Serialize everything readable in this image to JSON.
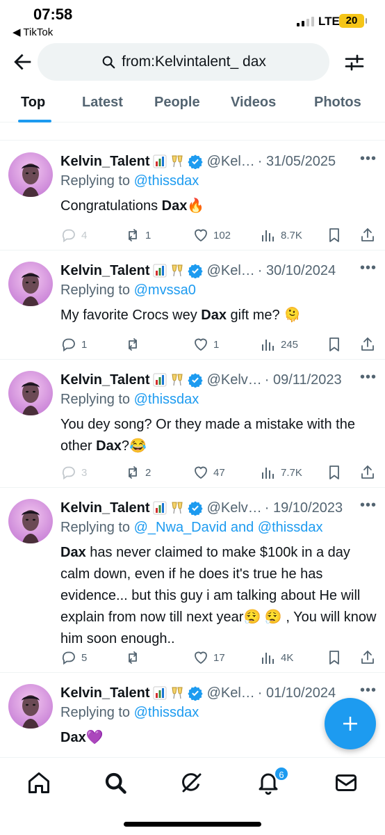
{
  "status_bar": {
    "time": "07:58",
    "back_app": "◀ TikTok",
    "network": "LTE",
    "battery": "20"
  },
  "search": {
    "query": "from:Kelvintalent_ dax"
  },
  "tabs": [
    {
      "label": "Top",
      "active": true
    },
    {
      "label": "Latest",
      "active": false
    },
    {
      "label": "People",
      "active": false
    },
    {
      "label": "Videos",
      "active": false
    },
    {
      "label": "Photos",
      "active": false
    }
  ],
  "tweets": [
    {
      "name": "Kelvin_Talent",
      "handle": "@Kel…",
      "date": "· 31/05/2025",
      "replying_prefix": "Replying to ",
      "replying_to": "@thissdax",
      "text_before": "Congratulations ",
      "bold": "Dax",
      "text_after": "🔥",
      "replies": "4",
      "reposts": "1",
      "likes": "102",
      "views": "8.7K",
      "replies_faded": true
    },
    {
      "name": "Kelvin_Talent",
      "handle": "@Kel…",
      "date": "· 30/10/2024",
      "replying_prefix": "Replying to ",
      "replying_to": "@mvssa0",
      "text_before": "My favorite Crocs wey ",
      "bold": "Dax",
      "text_after": " gift me? 🫠",
      "replies": "1",
      "reposts": "",
      "likes": "1",
      "views": "245",
      "replies_faded": false
    },
    {
      "name": "Kelvin_Talent",
      "handle": "@Kelv…",
      "date": "· 09/11/2023",
      "replying_prefix": "Replying to ",
      "replying_to": "@thissdax",
      "text_before": "You dey song? Or they made a mistake with the other ",
      "bold": "Dax",
      "text_after": "?😂",
      "replies": "3",
      "reposts": "2",
      "likes": "47",
      "views": "7.7K",
      "replies_faded": true
    },
    {
      "name": "Kelvin_Talent",
      "handle": "@Kelv…",
      "date": "· 19/10/2023",
      "replying_prefix": "Replying to ",
      "replying_to": "@_Nwa_David and @thissdax",
      "text_before": "",
      "bold": "Dax",
      "text_after": " has never claimed to make $100k in a day calm down, even if he does it's true he has evidence... but this guy i am talking about He will explain from now till next year😮‍💨 😮‍💨 , You will know him soon enough..",
      "replies": "5",
      "reposts": "",
      "likes": "17",
      "views": "4K",
      "replies_faded": false
    },
    {
      "name": "Kelvin_Talent",
      "handle": "@Kel…",
      "date": "· 01/10/2024",
      "replying_prefix": "Replying to ",
      "replying_to": "@thissdax",
      "text_before": "",
      "bold": "Dax",
      "text_after": "💜"
    }
  ],
  "notifications_badge": "6",
  "colors": {
    "accent": "#1d9bf0",
    "text": "#0f1419",
    "muted": "#536471",
    "pill": "#eff3f4",
    "battery": "#f5c518"
  },
  "icons": [
    "back-arrow-icon",
    "search-icon",
    "filter-icon",
    "verified-icon",
    "chart-emoji-icon",
    "champagne-icon",
    "more-icon",
    "reply-icon",
    "repost-icon",
    "like-icon",
    "views-icon",
    "bookmark-icon",
    "share-icon",
    "compose-icon",
    "home-icon",
    "explore-icon",
    "grok-icon",
    "notifications-icon",
    "messages-icon"
  ]
}
